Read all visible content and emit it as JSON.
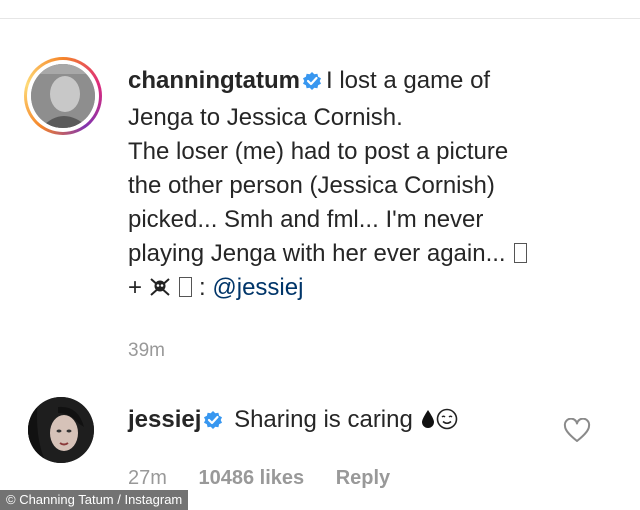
{
  "post": {
    "username": "channingtatum",
    "caption_line1": "I lost a game of",
    "caption_line2": "Jenga to Jessica Cornish.",
    "caption_line3": "The loser (me) had to post a picture",
    "caption_line4": "the other person (Jessica Cornish)",
    "caption_line5": "picked... Smh and fml... I'm never",
    "caption_line6": "playing Jenga with her ever again...",
    "caption_line7_prefix": "+",
    "caption_line7_sep": ":",
    "mention": "@jessiej",
    "time": "39m"
  },
  "comment": {
    "username": "jessiej",
    "text": "Sharing is caring",
    "time": "27m",
    "likes": "10486 likes",
    "reply": "Reply"
  },
  "credit": "© Channing Tatum / Instagram",
  "colors": {
    "verified": "#3897f0",
    "mention": "#003569",
    "meta": "#999999"
  }
}
